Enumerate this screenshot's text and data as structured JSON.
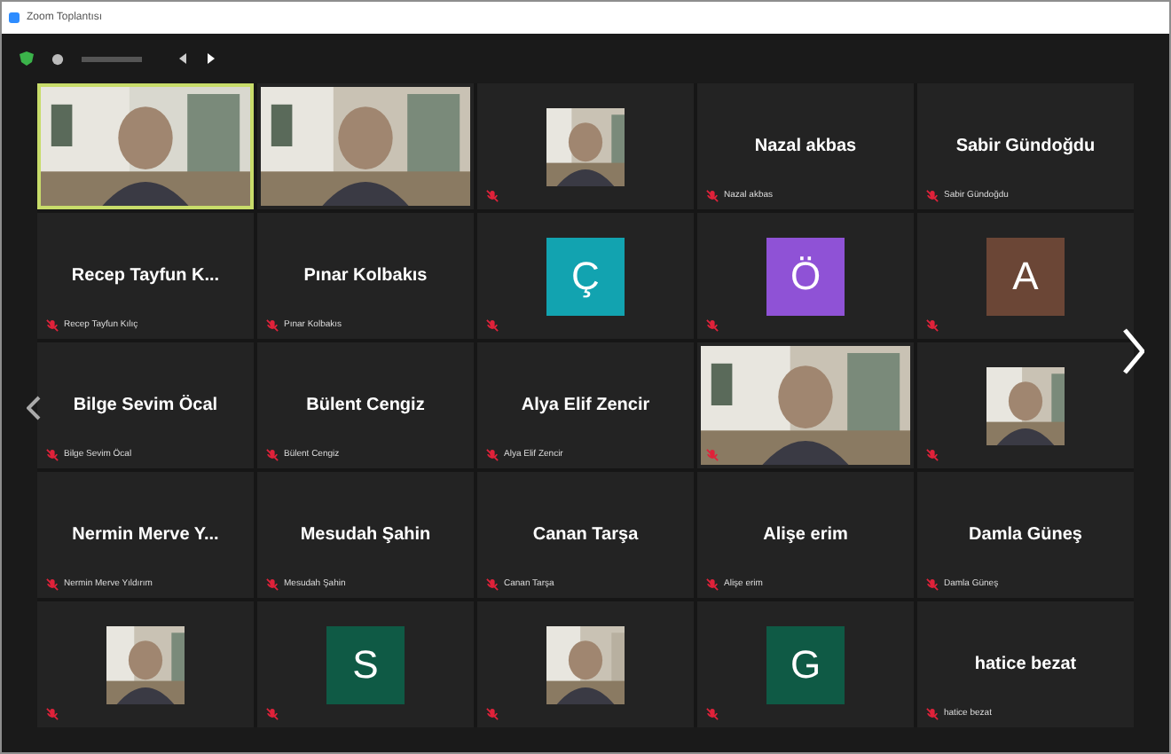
{
  "window": {
    "title": "Zoom Toplantısı"
  },
  "tiles": [
    {
      "kind": "video",
      "speaking": true,
      "muted": false
    },
    {
      "kind": "video",
      "speaking": false,
      "muted": false
    },
    {
      "kind": "thumb",
      "speaking": false,
      "muted": true
    },
    {
      "kind": "name",
      "name": "Nazal akbas",
      "label": "Nazal akbas",
      "speaking": false,
      "muted": true
    },
    {
      "kind": "name",
      "name": "Sabir Gündoğdu",
      "label": "Sabir Gündoğdu",
      "speaking": false,
      "muted": true
    },
    {
      "kind": "name",
      "name": "Recep Tayfun K...",
      "label": "Recep Tayfun Kılıç",
      "speaking": false,
      "muted": true
    },
    {
      "kind": "name",
      "name": "Pınar Kolbakıs",
      "label": "Pınar Kolbakıs",
      "speaking": false,
      "muted": true
    },
    {
      "kind": "avatar",
      "initial": "Ç",
      "color": "#12a3b0",
      "speaking": false,
      "muted": true
    },
    {
      "kind": "avatar",
      "initial": "Ö",
      "color": "#8f52d6",
      "speaking": false,
      "muted": true
    },
    {
      "kind": "avatar",
      "initial": "A",
      "color": "#6b4636",
      "speaking": false,
      "muted": true
    },
    {
      "kind": "name",
      "name": "Bilge Sevim Öcal",
      "label": "Bilge Sevim Öcal",
      "speaking": false,
      "muted": true
    },
    {
      "kind": "name",
      "name": "Bülent Cengiz",
      "label": "Bülent Cengiz",
      "speaking": false,
      "muted": true
    },
    {
      "kind": "name",
      "name": "Alya Elif Zencir",
      "label": "Alya Elif Zencir",
      "speaking": false,
      "muted": true
    },
    {
      "kind": "video",
      "speaking": false,
      "muted": true
    },
    {
      "kind": "thumb",
      "speaking": false,
      "muted": true
    },
    {
      "kind": "name",
      "name": "Nermin Merve Y...",
      "label": "Nermin Merve Yıldırım",
      "speaking": false,
      "muted": true
    },
    {
      "kind": "name",
      "name": "Mesudah Şahin",
      "label": "Mesudah Şahin",
      "speaking": false,
      "muted": true
    },
    {
      "kind": "name",
      "name": "Canan Tarşa",
      "label": "Canan Tarşa",
      "speaking": false,
      "muted": true
    },
    {
      "kind": "name",
      "name": "Alişe erim",
      "label": "Alişe erim",
      "speaking": false,
      "muted": true
    },
    {
      "kind": "name",
      "name": "Damla Güneş",
      "label": "Damla Güneş",
      "speaking": false,
      "muted": true
    },
    {
      "kind": "thumb",
      "speaking": false,
      "muted": true
    },
    {
      "kind": "avatar",
      "initial": "S",
      "color": "#0f5a45",
      "speaking": false,
      "muted": true
    },
    {
      "kind": "thumb",
      "speaking": false,
      "muted": true
    },
    {
      "kind": "avatar",
      "initial": "G",
      "color": "#0f5a45",
      "speaking": false,
      "muted": true
    },
    {
      "kind": "name",
      "name": "hatice bezat",
      "label": "hatice bezat",
      "speaking": false,
      "muted": true
    }
  ]
}
